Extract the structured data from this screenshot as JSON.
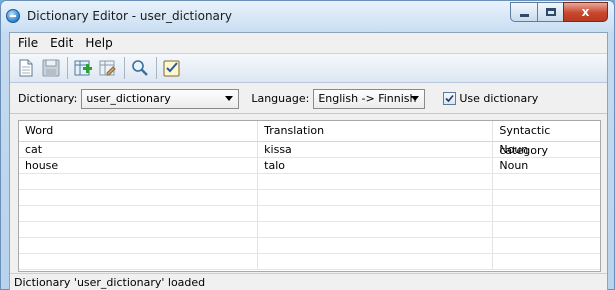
{
  "window": {
    "title": "Dictionary Editor - user_dictionary",
    "controls": {
      "minimize": "minimize",
      "maximize": "maximize",
      "close": "x"
    }
  },
  "menu": [
    "File",
    "Edit",
    "Help"
  ],
  "toolbar": {
    "buttons": [
      "new-document-icon",
      "save-icon",
      "add-entry-icon",
      "edit-entry-icon",
      "search-icon",
      "check-icon"
    ]
  },
  "filters": {
    "dictionary_label": "Dictionary:",
    "dictionary_value": "user_dictionary",
    "language_label": "Language:",
    "language_value": "English -> Finnish",
    "use_dictionary_label": "Use dictionary",
    "use_dictionary_checked": true
  },
  "table": {
    "columns": [
      "Word",
      "Translation",
      "Syntactic category"
    ],
    "rows": [
      [
        "cat",
        "kissa",
        "Noun"
      ],
      [
        "house",
        "talo",
        "Noun"
      ]
    ]
  },
  "status": "Dictionary 'user_dictionary' loaded"
}
